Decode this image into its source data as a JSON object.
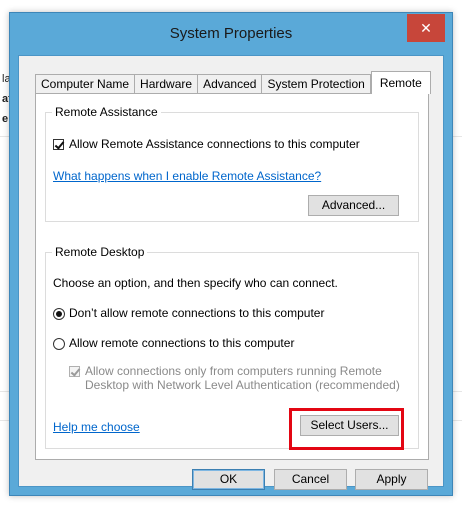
{
  "window": {
    "title": "System Properties",
    "close_glyph": "✕"
  },
  "tabs": [
    {
      "label": "Computer Name"
    },
    {
      "label": "Hardware"
    },
    {
      "label": "Advanced"
    },
    {
      "label": "System Protection"
    },
    {
      "label": "Remote"
    }
  ],
  "remote_assistance": {
    "group_label": "Remote Assistance",
    "allow_checkbox_label": "Allow Remote Assistance connections to this computer",
    "allow_checked": true,
    "help_link": "What happens when I enable Remote Assistance?",
    "advanced_button": "Advanced..."
  },
  "remote_desktop": {
    "group_label": "Remote Desktop",
    "instruction": "Choose an option, and then specify who can connect.",
    "option_dont_allow": "Don’t allow remote connections to this computer",
    "option_allow": "Allow remote connections to this computer",
    "selected_option": "dont_allow",
    "nla_line1": "Allow connections only from computers running Remote",
    "nla_line2": "Desktop with Network Level Authentication (recommended)",
    "nla_checked": true,
    "help_link": "Help me choose",
    "select_users_button": "Select Users..."
  },
  "footer": {
    "ok_button": "OK",
    "cancel_button": "Cancel",
    "apply_button": "Apply"
  },
  "background": {
    "fragments": [
      "la",
      "at",
      "e"
    ]
  },
  "colors": {
    "frame": "#5aa9d8",
    "close": "#c7463a",
    "link": "#0066cc",
    "highlight": "#e30613"
  },
  "icons": {
    "close": "close-icon",
    "checkbox": "checkmark-icon",
    "radio": "radio-dot-icon"
  }
}
